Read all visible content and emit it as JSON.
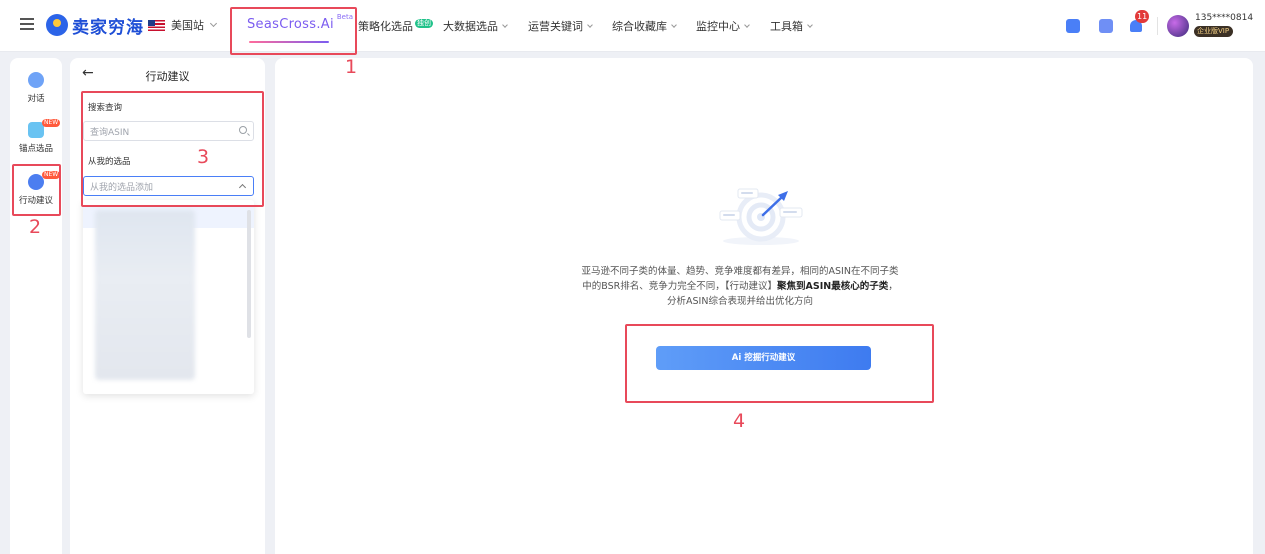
{
  "topbar": {
    "logo_text": "卖家穷海",
    "site_label": "美国站",
    "ai_nav_label": "SeasCross.Ai",
    "ai_nav_beta": "Beta",
    "nav_items": [
      {
        "label": "策略化选品",
        "badge": "独创"
      },
      {
        "label": "大数据选品"
      },
      {
        "label": "运营关键词"
      },
      {
        "label": "综合收藏库"
      },
      {
        "label": "监控中心"
      },
      {
        "label": "工具箱"
      }
    ],
    "notification_count": "11",
    "user_name": "135****0814",
    "vip_label": "企业版VIP"
  },
  "rail": {
    "items": [
      {
        "label": "对话",
        "icon": "chat-bot-icon"
      },
      {
        "label": "锚点选品",
        "icon": "cube-icon",
        "badge": "NEW"
      },
      {
        "label": "行动建议",
        "icon": "compass-icon",
        "badge": "NEW"
      }
    ]
  },
  "panel": {
    "title": "行动建议",
    "search_label": "搜索查询",
    "search_placeholder": "查询ASIN",
    "mine_label": "从我的选品",
    "mine_placeholder": "从我的选品添加"
  },
  "main": {
    "desc_line1": "亚马逊不同子类的体量、趋势、竞争难度都有差异，相同的ASIN在不同子类",
    "desc_line2_prefix": "中的BSR排名、竞争力完全不同，【行动建议】",
    "desc_line2_bold": "聚焦到ASIN最核心的子类",
    "desc_line2_suffix": "，",
    "desc_line3": "分析ASIN综合表现并给出优化方向",
    "button_label": "Ai 挖掘行动建议"
  },
  "annotations": {
    "labels": [
      "1",
      "2",
      "3",
      "4"
    ],
    "color": "#e8495a"
  }
}
